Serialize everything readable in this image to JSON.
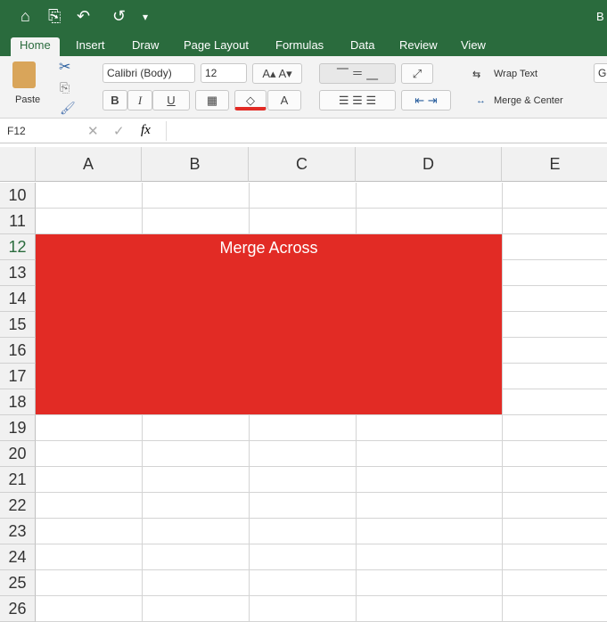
{
  "quick_access": {
    "home": "⌂",
    "save": "⎘",
    "undo": "↶",
    "redo": "↺",
    "customize": "▾",
    "account": "B"
  },
  "tabs": [
    "Home",
    "Insert",
    "Draw",
    "Page Layout",
    "Formulas",
    "Data",
    "Review",
    "View"
  ],
  "ribbon": {
    "paste": "Paste",
    "font_name": "Calibri (Body)",
    "font_size": "12",
    "grow": "A▴",
    "shrink": "A▾",
    "bold": "B",
    "italic": "I",
    "underline": "U",
    "font_color": "A",
    "wrap_text": "Wrap Text",
    "merge_center": "Merge & Center",
    "number_format": "Ge"
  },
  "formula_bar": {
    "name_box": "F12",
    "cancel": "✕",
    "enter": "✓",
    "fx": "fx",
    "value": ""
  },
  "columns": [
    "A",
    "B",
    "C",
    "D",
    "E"
  ],
  "rows": [
    "10",
    "11",
    "12",
    "13",
    "14",
    "15",
    "16",
    "17",
    "18",
    "19",
    "20",
    "21",
    "22",
    "23",
    "24",
    "25",
    "26"
  ],
  "merged_cell": {
    "text": "Merge Across",
    "fill": "#e22b25"
  }
}
